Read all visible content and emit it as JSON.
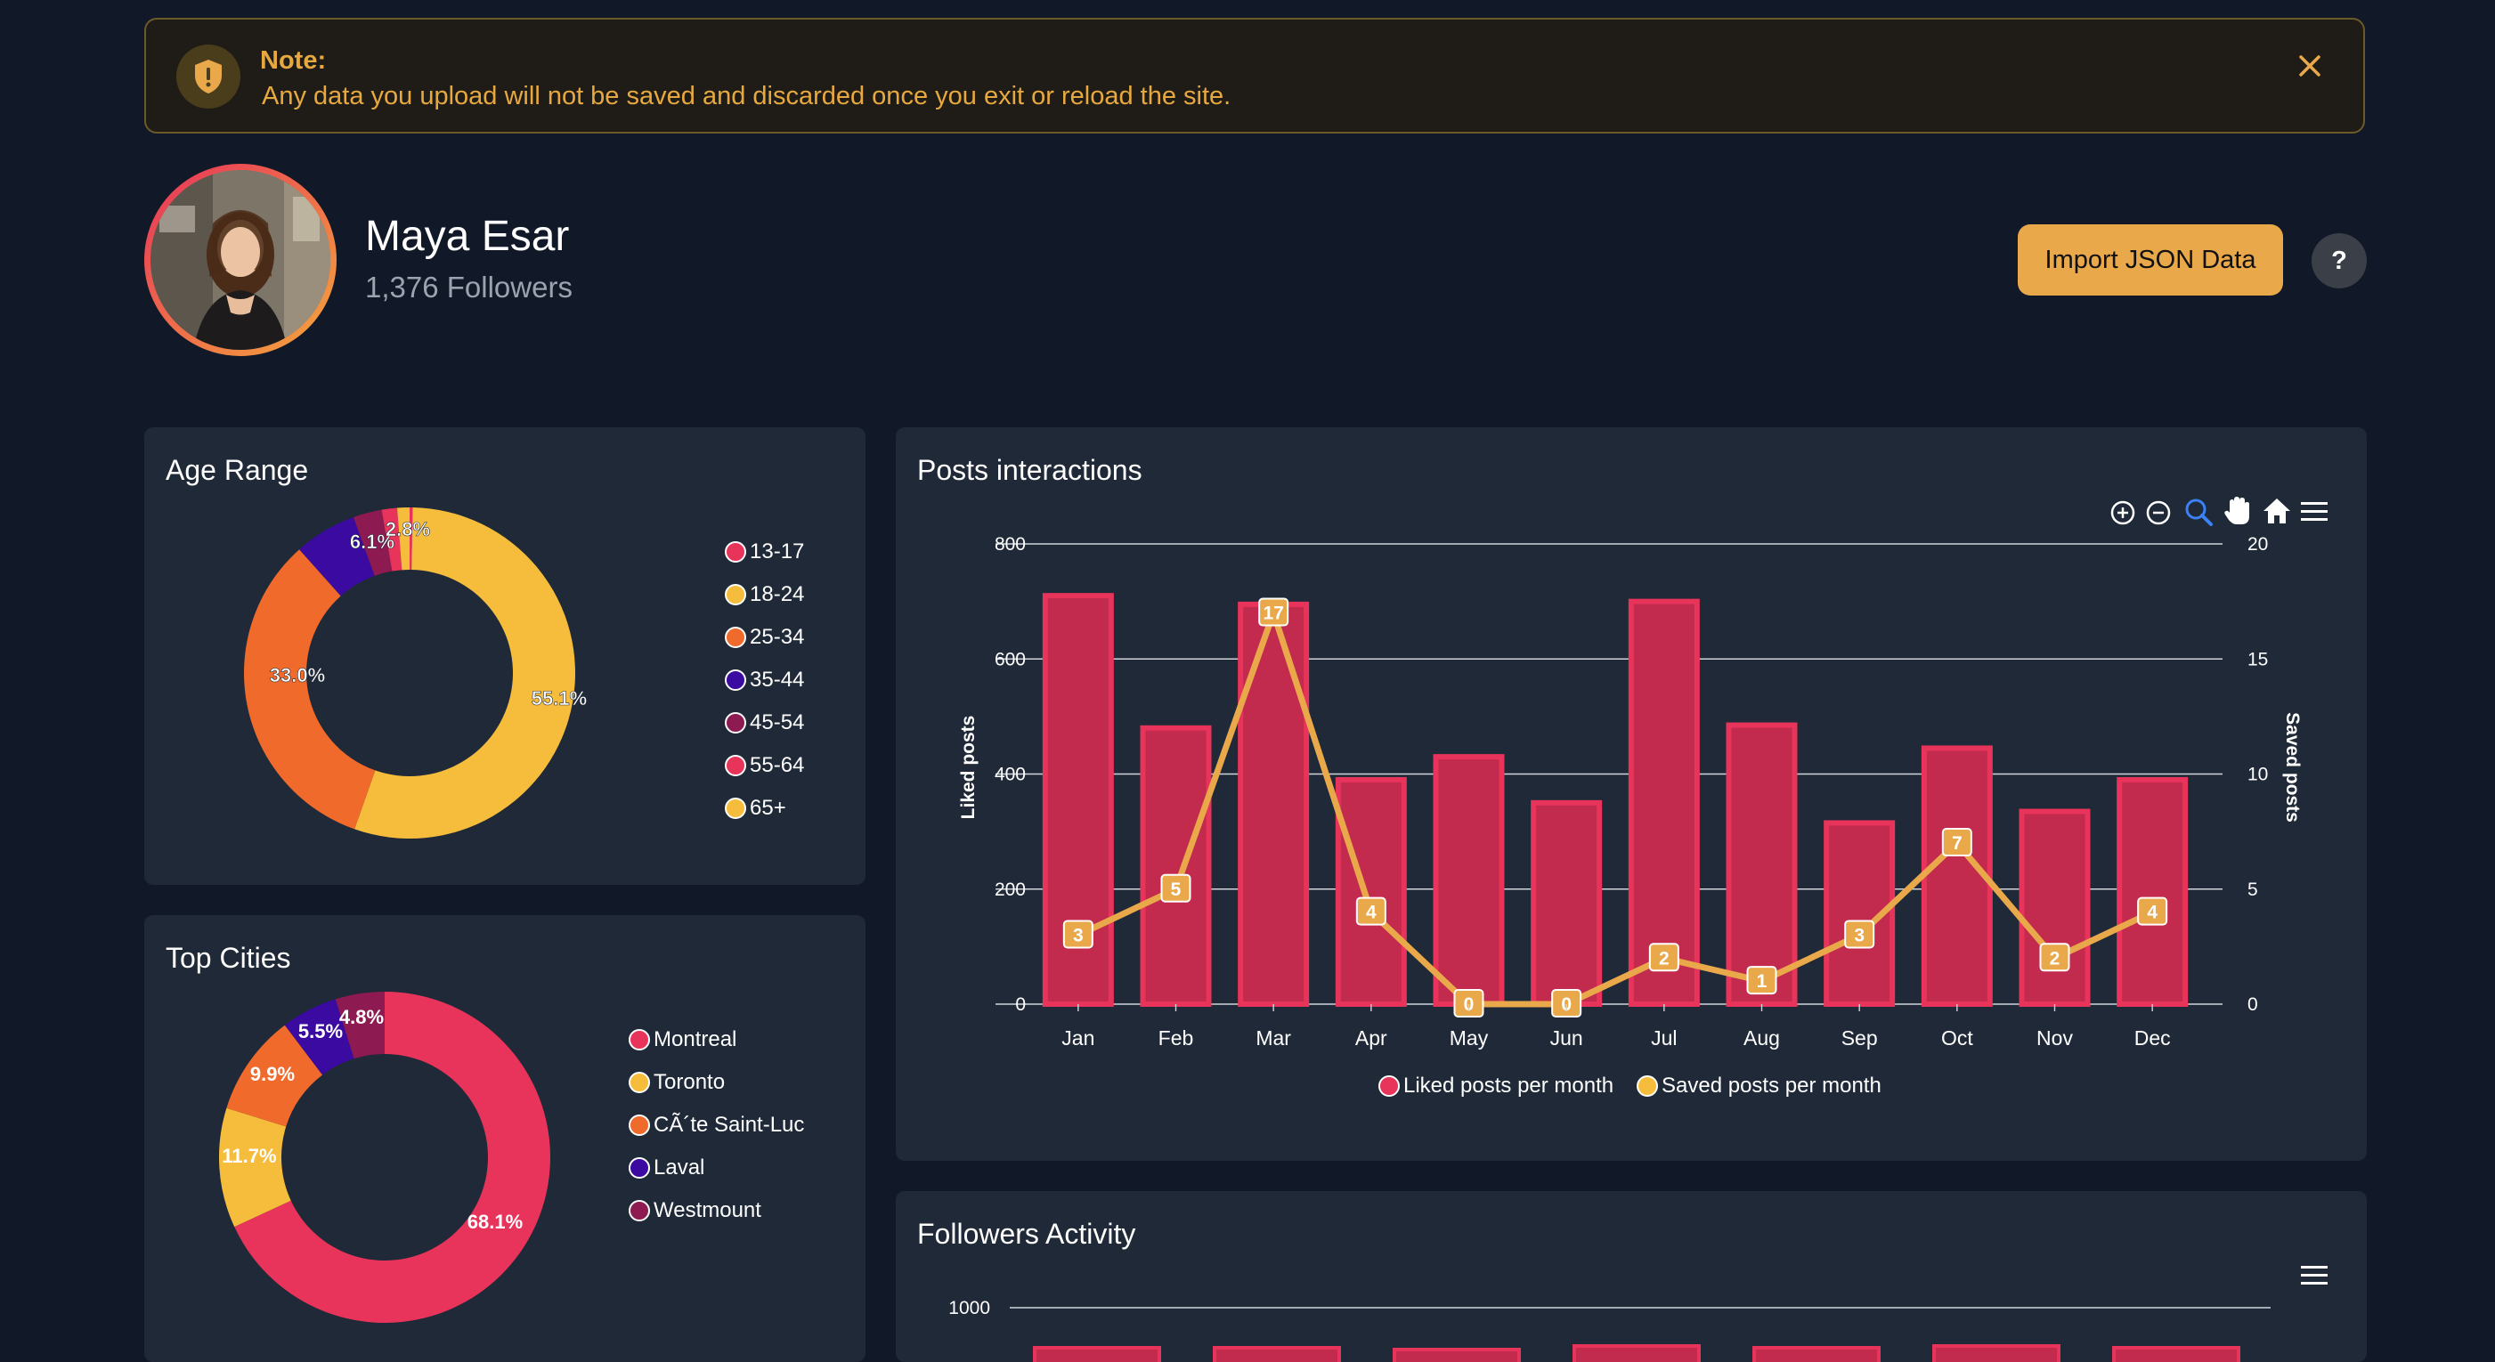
{
  "notice": {
    "title": "Note:",
    "text": "Any data you upload will not be saved and discarded once you exit or reload the site."
  },
  "profile": {
    "name": "Maya Esar",
    "followers": "1,376 Followers"
  },
  "actions": {
    "import_label": "Import JSON Data",
    "help_label": "?"
  },
  "colors": {
    "accent": "#e9a84a",
    "pink": "#e8335a",
    "yellow": "#f6bd3c",
    "orange": "#ef6a2b",
    "indigo": "#3b0aa0",
    "plum": "#8e1a52",
    "background": "#111827",
    "card": "#1f2937"
  },
  "icons": [
    "shield-alert-icon",
    "close-icon",
    "zoom-in-icon",
    "zoom-out-icon",
    "zoom-selection-icon",
    "pan-hand-icon",
    "home-reset-icon",
    "menu-icon"
  ],
  "age_range": {
    "title": "Age Range",
    "legend": [
      "13-17",
      "18-24",
      "25-34",
      "35-44",
      "45-54",
      "55-64",
      "65+"
    ],
    "labels": [
      "6.1%",
      "2.8%",
      "33.0%",
      "55.1%"
    ]
  },
  "top_cities": {
    "title": "Top Cities",
    "legend": [
      "Montreal",
      "Toronto",
      "CÃ´te Saint-Luc",
      "Laval",
      "Westmount"
    ],
    "labels": [
      "5.5%",
      "4.8%",
      "9.9%",
      "11.7%",
      "68.1%"
    ]
  },
  "posts": {
    "title": "Posts interactions",
    "left_axis_label": "Liked posts",
    "right_axis_label": "Saved posts",
    "left_ticks": [
      "800",
      "600",
      "400",
      "200",
      "0"
    ],
    "right_ticks": [
      "20",
      "15",
      "10",
      "5",
      "0"
    ],
    "legend": [
      "Liked posts per month",
      "Saved posts per month"
    ]
  },
  "followers_activity": {
    "title": "Followers Activity",
    "tick_top": "1000"
  },
  "chart_data": [
    {
      "type": "pie",
      "title": "Age Range",
      "categories": [
        "13-17",
        "18-24",
        "25-34",
        "35-44",
        "45-54",
        "55-64",
        "65+"
      ],
      "values": [
        0.3,
        55.1,
        33.0,
        6.1,
        2.8,
        1.5,
        1.2
      ]
    },
    {
      "type": "pie",
      "title": "Top Cities",
      "categories": [
        "Montreal",
        "Toronto",
        "CÃ´te Saint-Luc",
        "Laval",
        "Westmount"
      ],
      "values": [
        68.1,
        11.7,
        9.9,
        5.5,
        4.8
      ]
    },
    {
      "type": "bar",
      "title": "Posts interactions",
      "categories": [
        "Jan",
        "Feb",
        "Mar",
        "Apr",
        "May",
        "Jun",
        "Jul",
        "Aug",
        "Sep",
        "Oct",
        "Nov",
        "Dec"
      ],
      "series": [
        {
          "name": "Liked posts per month",
          "type": "bar",
          "axis": "left",
          "values": [
            710,
            480,
            695,
            390,
            430,
            350,
            700,
            485,
            315,
            445,
            335,
            390
          ]
        },
        {
          "name": "Saved posts per month",
          "type": "line",
          "axis": "right",
          "values": [
            3,
            5,
            17,
            4,
            0,
            0,
            2,
            1,
            3,
            7,
            2,
            4
          ]
        }
      ],
      "ylabel": "Liked posts",
      "ylabel_right": "Saved posts",
      "ylim": [
        0,
        800
      ],
      "ylim_right": [
        0,
        20
      ],
      "grid": true,
      "legend": "bottom"
    },
    {
      "type": "bar",
      "title": "Followers Activity",
      "ylim": [
        0,
        1000
      ],
      "values": [],
      "note": ""
    }
  ]
}
